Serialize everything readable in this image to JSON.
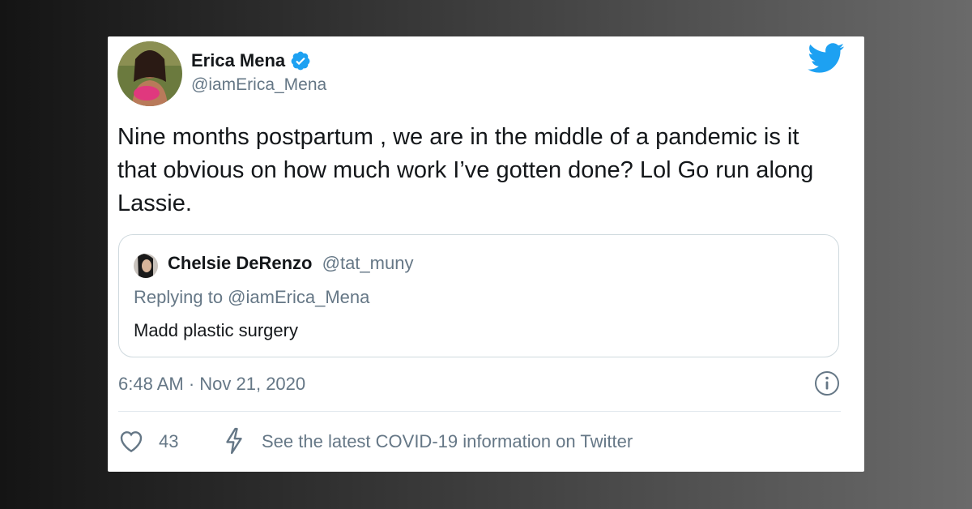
{
  "tweet": {
    "author_name": "Erica Mena",
    "author_handle": "@iamErica_Mena",
    "text": "Nine months postpartum , we are in the middle of a pandemic is it that obvious on how much work I’ve gotten done? Lol Go run along Lassie.",
    "timestamp": "6:48 AM · Nov 21, 2020",
    "like_count": "43",
    "covid_link": "See the latest COVID-19 information on Twitter"
  },
  "quote": {
    "author_name": "Chelsie DeRenzo",
    "author_handle": "@tat_muny",
    "replying_to": "Replying to @iamErica_Mena",
    "text": "Madd plastic surgery"
  },
  "colors": {
    "brand": "#1da1f2",
    "secondary_text": "#657786",
    "primary_text": "#14171a"
  },
  "icons": [
    "verified-badge-icon",
    "twitter-bird-icon",
    "info-icon",
    "heart-icon",
    "lightning-bolt-icon"
  ]
}
